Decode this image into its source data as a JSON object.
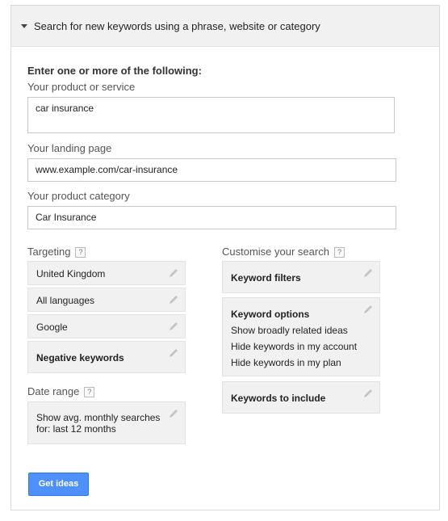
{
  "header": {
    "title": "Search for new keywords using a phrase, website or category"
  },
  "form": {
    "intro": "Enter one or more of the following:",
    "product_label": "Your product or service",
    "product_value": "car insurance",
    "landing_label": "Your landing page",
    "landing_value": "www.example.com/car-insurance",
    "category_label": "Your product category",
    "category_value": "Car Insurance"
  },
  "targeting": {
    "label": "Targeting",
    "help": "?",
    "items": [
      "United Kingdom",
      "All languages",
      "Google",
      "Negative keywords"
    ]
  },
  "date_range": {
    "label": "Date range",
    "help": "?",
    "value_line1": "Show avg. monthly searches",
    "value_line2": "for: last 12 months"
  },
  "customise": {
    "label": "Customise your search",
    "help": "?",
    "filters": "Keyword filters",
    "options_title": "Keyword options",
    "options": [
      "Show broadly related ideas",
      "Hide keywords in my account",
      "Hide keywords in my plan"
    ],
    "include": "Keywords to include"
  },
  "actions": {
    "get_ideas": "Get ideas"
  },
  "icons": {
    "edit": "pencil-icon",
    "collapse": "caret-down-icon",
    "help": "help-icon"
  }
}
